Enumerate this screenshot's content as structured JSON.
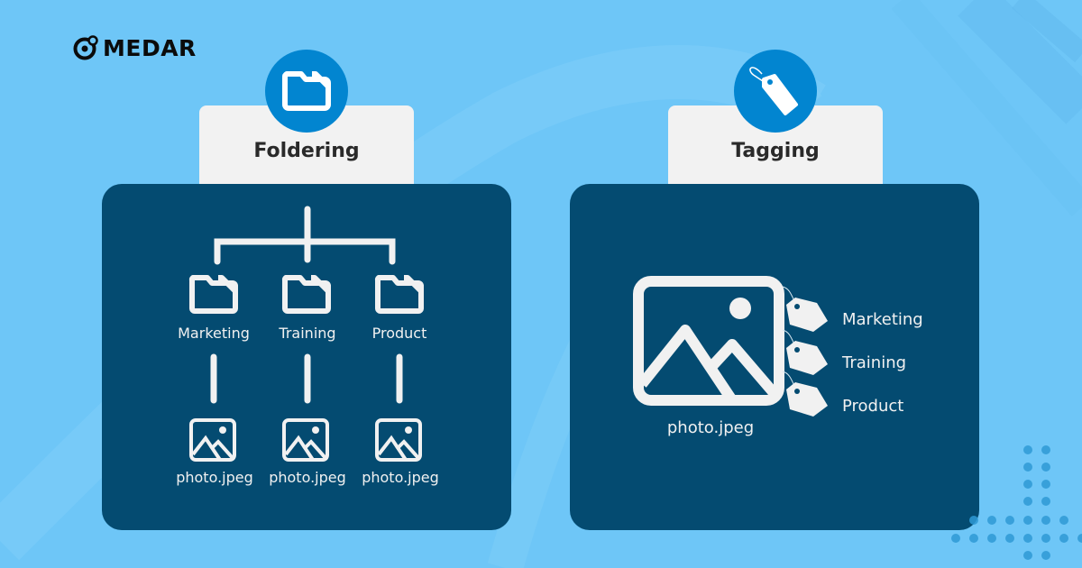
{
  "brand": {
    "name": "MEDAR",
    "logo_icon": "medar-logo-icon"
  },
  "colors": {
    "background": "#6ec6f7",
    "panel": "#044b71",
    "badge": "#0285d0",
    "tab": "#f2f2f2",
    "icon_fill": "#f1f1f1"
  },
  "foldering": {
    "title": "Foldering",
    "icon": "folder-icon",
    "folders": [
      {
        "label": "Marketing",
        "file": "photo.jpeg"
      },
      {
        "label": "Training",
        "file": "photo.jpeg"
      },
      {
        "label": "Product",
        "file": "photo.jpeg"
      }
    ]
  },
  "tagging": {
    "title": "Tagging",
    "icon": "tag-icon",
    "file": "photo.jpeg",
    "tags": [
      {
        "label": "Marketing"
      },
      {
        "label": "Training"
      },
      {
        "label": "Product"
      }
    ]
  }
}
